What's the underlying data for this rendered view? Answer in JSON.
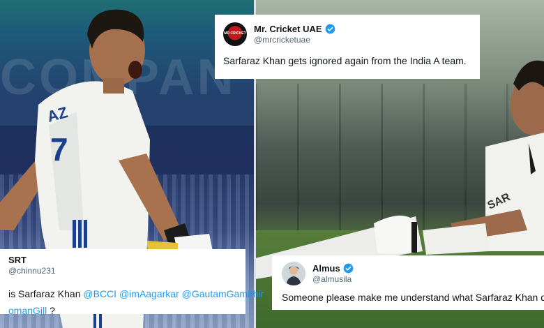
{
  "background": {
    "left_banner_text": "COMPAN"
  },
  "tweets": {
    "top": {
      "name": "Mr. Cricket UAE",
      "handle": "@mrcricketuae",
      "text": "Sarfaraz Khan gets ignored again from the India A team.",
      "avatar_icon": "mr-cricket-uae-logo"
    },
    "left": {
      "name": "SRT",
      "handle": "@chinnu231",
      "line1_prefix": "is Sarfaraz Khan ",
      "mention1": "@BCCI",
      "mention2": "@imAagarkar",
      "mention3": "@GautamGambhir",
      "mention4": "omanGill",
      "line2_suffix": " ?"
    },
    "right": {
      "name": "Almus",
      "handle": "@almusila",
      "text": "Someone please make me understand what Sarfaraz Khan did wro",
      "avatar_icon": "person-avatar-icon"
    }
  },
  "colors": {
    "verified": "#1d9bf0",
    "mention": "#1d9bf0"
  }
}
